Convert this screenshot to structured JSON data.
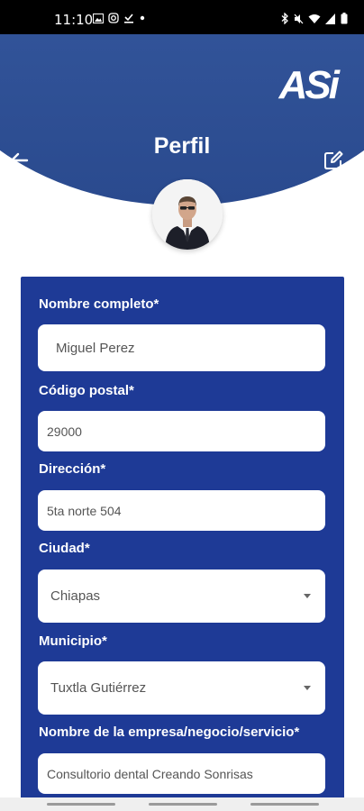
{
  "status_bar": {
    "time": "11:10",
    "left_icons": [
      "gallery-icon",
      "instagram-icon",
      "download-done-icon",
      "dot-icon"
    ],
    "right_icons": [
      "bluetooth-icon",
      "mute-icon",
      "wifi-icon",
      "signal-icon",
      "battery-icon"
    ]
  },
  "header": {
    "logo": "ASi",
    "title": "Perfil",
    "colors": {
      "gradient_top": "#3b5fa6",
      "gradient_bottom": "#2a4a8e"
    }
  },
  "form": {
    "background": "#1e3a96",
    "nombre": {
      "label": "Nombre completo*",
      "value": "Miguel Perez"
    },
    "codigo_postal": {
      "label": "Código postal*",
      "value": "29000"
    },
    "direccion": {
      "label": "Dirección*",
      "value": "5ta norte 504"
    },
    "ciudad": {
      "label": "Ciudad*",
      "value": "Chiapas"
    },
    "municipio": {
      "label": "Municipio*",
      "value": "Tuxtla Gutiérrez"
    },
    "empresa": {
      "label": "Nombre de la empresa/negocio/servicio*",
      "value": "Consultorio dental Creando Sonrisas"
    }
  }
}
